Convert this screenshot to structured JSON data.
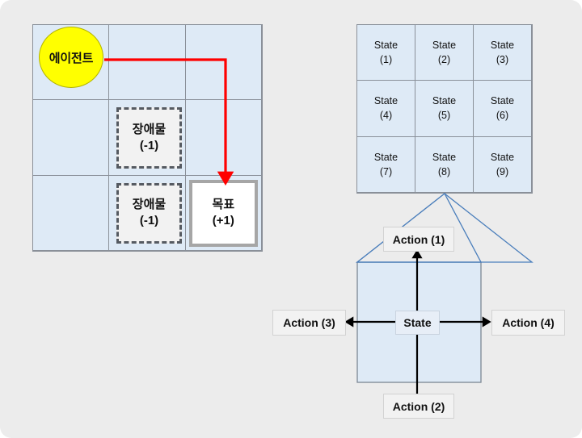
{
  "figure": {
    "background_color": "#ececec",
    "title": ""
  },
  "gridworld": {
    "name": "gridworld-3x3",
    "grid_fill": "#deeaf6",
    "grid_border": "#8a9099",
    "agent": {
      "label": "에이전트",
      "fill": "#ffff00",
      "stroke": "#b3b300",
      "cell": "r1c1"
    },
    "obstacles": [
      {
        "label": "장애물",
        "value": "(-1)",
        "cell": "r2c2"
      },
      {
        "label": "장애물",
        "value": "(-1)",
        "cell": "r3c2"
      }
    ],
    "goal": {
      "label": "목표",
      "value": "(+1)",
      "cell": "r3c3"
    },
    "path": {
      "color": "#ff0000",
      "description": "agent moves right then down to goal"
    }
  },
  "state_grid": {
    "name": "state-grid-3x3",
    "cells": [
      {
        "label": "State",
        "index": "(1)"
      },
      {
        "label": "State",
        "index": "(2)"
      },
      {
        "label": "State",
        "index": "(3)"
      },
      {
        "label": "State",
        "index": "(4)"
      },
      {
        "label": "State",
        "index": "(5)"
      },
      {
        "label": "State",
        "index": "(6)"
      },
      {
        "label": "State",
        "index": "(7)"
      },
      {
        "label": "State",
        "index": "(8)"
      },
      {
        "label": "State",
        "index": "(9)"
      }
    ]
  },
  "action_diagram": {
    "shape": "house",
    "shape_fill": "#deeaf6",
    "shape_stroke": "#4a7ebb",
    "center_label": "State",
    "actions": {
      "up": "Action (1)",
      "down": "Action (2)",
      "left": "Action (3)",
      "right": "Action (4)"
    },
    "arrow_color": "#000000"
  }
}
